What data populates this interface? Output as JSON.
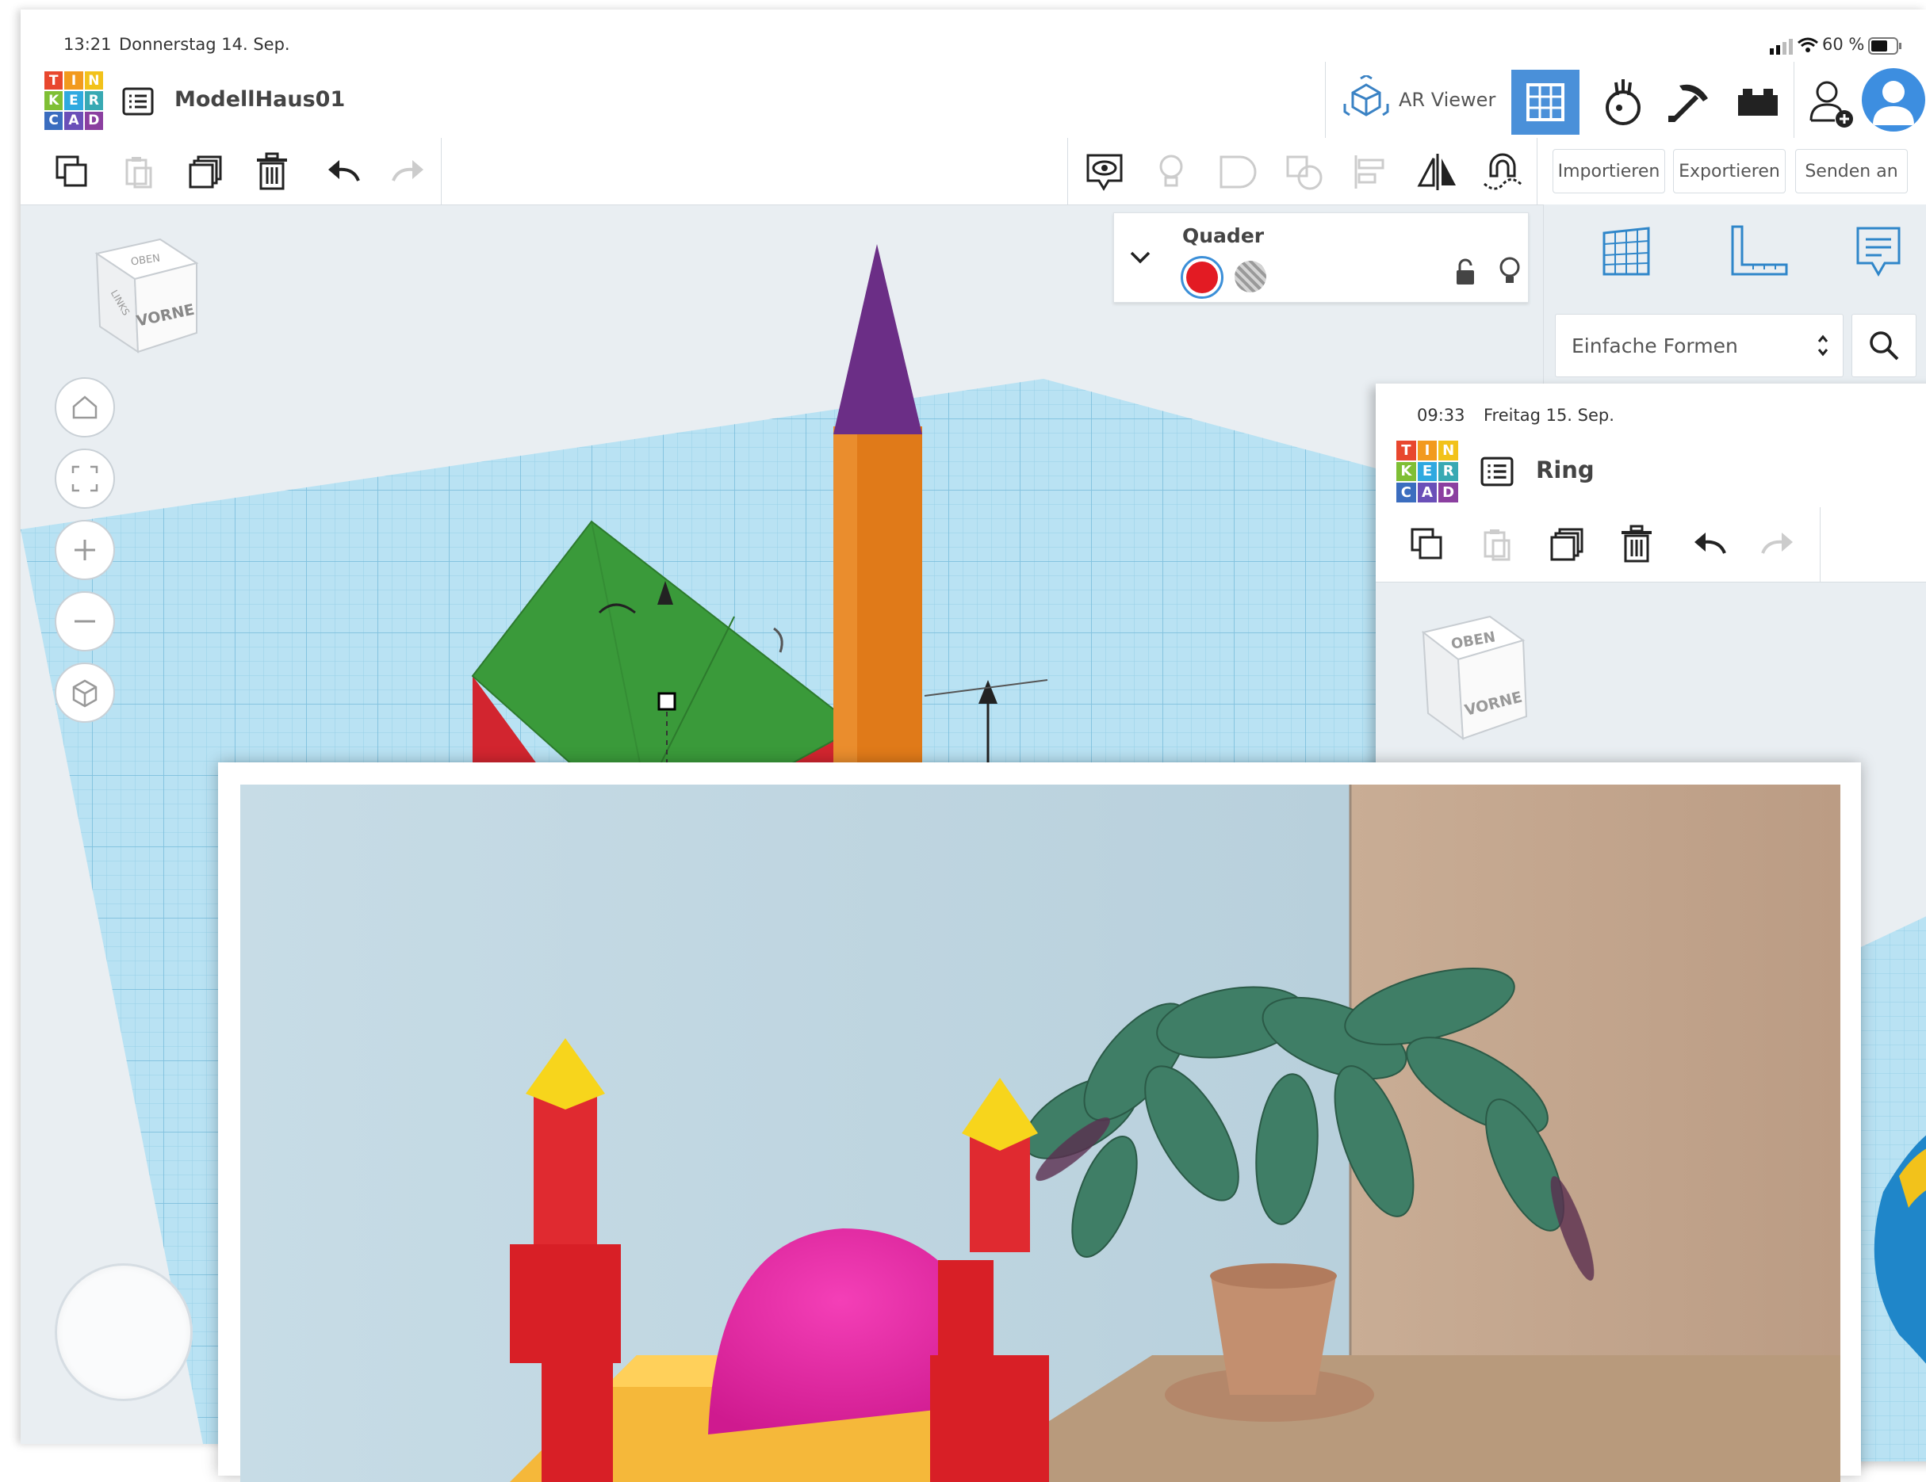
{
  "screen1": {
    "status": {
      "time": "13:21",
      "date": "Donnerstag 14. Sep.",
      "battery": "60 %"
    },
    "logo_letters": [
      "T",
      "I",
      "N",
      "K",
      "E",
      "R",
      "C",
      "A",
      "D"
    ],
    "project_name": "ModellHaus01",
    "ar_viewer_label": "AR Viewer",
    "toolbar": {
      "import_label": "Importieren",
      "export_label": "Exportieren",
      "send_label": "Senden an"
    },
    "view_cube": {
      "top": "OBEN",
      "front": "VORNE",
      "left": "LINKS"
    },
    "shape_panel": {
      "title": "Quader"
    },
    "library": {
      "selected": "Einfache Formen"
    }
  },
  "screen2": {
    "status": {
      "time": "09:33",
      "date": "Freitag 15. Sep."
    },
    "logo_letters": [
      "T",
      "I",
      "N",
      "K",
      "E",
      "R",
      "C",
      "A",
      "D"
    ],
    "project_name": "Ring",
    "view_cube": {
      "top": "OBEN",
      "front": "VORNE"
    }
  },
  "colors": {
    "logo": [
      "#e8472e",
      "#f29a1e",
      "#f2c21b",
      "#7fbf35",
      "#2fa9e0",
      "#38a9b3",
      "#3b6dbf",
      "#6a4fb8",
      "#8b3fa0"
    ],
    "accent": "#2f86c9",
    "shape_red": "#e31b23",
    "grid": "#a9d8ec"
  }
}
